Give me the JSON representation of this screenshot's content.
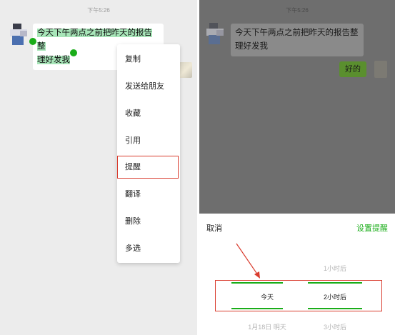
{
  "left": {
    "timestamp": "下午5:26",
    "message": {
      "line1": "今天下午两点之前把昨天的报告整",
      "line2": "理好发我"
    },
    "context_menu": [
      "复制",
      "发送给朋友",
      "收藏",
      "引用",
      "提醒",
      "翻译",
      "删除",
      "多选"
    ],
    "highlighted_item": "提醒"
  },
  "right": {
    "timestamp": "下午5:26",
    "message_in": {
      "line1": "今天下午两点之前把昨天的报告整",
      "line2": "理好发我"
    },
    "message_out": "好的",
    "sheet": {
      "cancel": "取消",
      "confirm": "设置提醒",
      "picker": {
        "above_time": "1小时后",
        "selected_day": "今天",
        "selected_time": "2小时后",
        "below_day": "1月18日 明天",
        "below_time": "3小时后"
      }
    }
  },
  "colors": {
    "accent_green": "#1aad19",
    "selection_highlight": "#a8e6b9",
    "annotation_red": "#d93c2e"
  }
}
